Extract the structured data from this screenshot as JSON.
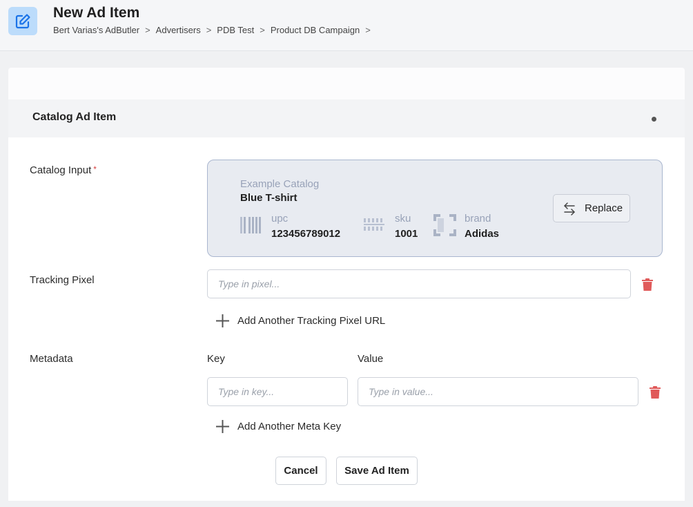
{
  "header": {
    "title": "New Ad Item",
    "breadcrumb": [
      "Bert Varias's AdButler",
      "Advertisers",
      "PDB Test",
      "Product DB Campaign"
    ],
    "separator": ">"
  },
  "section": {
    "title": "Catalog Ad Item"
  },
  "catalog_input": {
    "label": "Catalog Input",
    "required_mark": "*",
    "catalog_name": "Example Catalog",
    "item_name": "Blue T-shirt",
    "attributes": [
      {
        "label": "upc",
        "value": "123456789012",
        "icon": "barcode-icon"
      },
      {
        "label": "sku",
        "value": "1001",
        "icon": "sku-barcode-icon"
      },
      {
        "label": "brand",
        "value": "Adidas",
        "icon": "brand-frame-icon"
      }
    ],
    "replace_label": "Replace"
  },
  "tracking_pixel": {
    "label": "Tracking Pixel",
    "value": "",
    "placeholder": "Type in pixel...",
    "add_label": "Add Another Tracking Pixel URL"
  },
  "metadata": {
    "label": "Metadata",
    "key_header": "Key",
    "value_header": "Value",
    "key_value": "",
    "key_placeholder": "Type in key...",
    "value_value": "",
    "value_placeholder": "Type in value...",
    "add_label": "Add Another Meta Key"
  },
  "actions": {
    "cancel_label": "Cancel",
    "save_label": "Save Ad Item"
  },
  "colors": {
    "accent": "#1a73e8",
    "icon_bg": "#bcdcfb",
    "danger": "#e05a5a"
  }
}
